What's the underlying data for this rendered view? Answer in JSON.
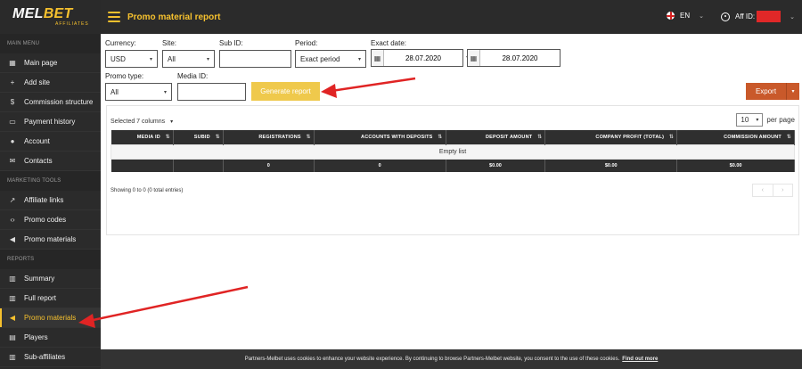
{
  "brand": {
    "name_left": "MEL",
    "name_right": "BET",
    "sub": "AFFILIATES"
  },
  "topbar": {
    "title": "Promo material report",
    "language": "EN",
    "aff_label": "Aff ID:"
  },
  "sidebar": {
    "sections": [
      {
        "title": "MAIN MENU",
        "items": [
          {
            "label": "Main page",
            "icon": "dashboard-icon"
          },
          {
            "label": "Add site",
            "icon": "plus-icon"
          },
          {
            "label": "Commission structure",
            "icon": "dollar-icon"
          },
          {
            "label": "Payment history",
            "icon": "wallet-icon"
          },
          {
            "label": "Account",
            "icon": "user-icon"
          },
          {
            "label": "Contacts",
            "icon": "envelope-icon"
          }
        ]
      },
      {
        "title": "MARKETING TOOLS",
        "items": [
          {
            "label": "Affiliate links",
            "icon": "external-link-icon"
          },
          {
            "label": "Promo codes",
            "icon": "code-icon"
          },
          {
            "label": "Promo materials",
            "icon": "megaphone-icon"
          }
        ]
      },
      {
        "title": "REPORTS",
        "items": [
          {
            "label": "Summary",
            "icon": "bar-chart-icon"
          },
          {
            "label": "Full report",
            "icon": "bar-chart-icon"
          },
          {
            "label": "Promo materials",
            "icon": "megaphone-icon",
            "active": true
          },
          {
            "label": "Players",
            "icon": "id-card-icon"
          },
          {
            "label": "Sub-affiliates",
            "icon": "bar-chart-icon"
          }
        ]
      }
    ]
  },
  "filters": {
    "currency": {
      "label": "Currency:",
      "value": "USD"
    },
    "site": {
      "label": "Site:",
      "value": "All"
    },
    "sub_id": {
      "label": "Sub ID:",
      "value": ""
    },
    "period": {
      "label": "Period:",
      "value": "Exact period"
    },
    "exact_date": {
      "label": "Exact date:",
      "from": "28.07.2020",
      "separator": "-",
      "to": "28.07.2020"
    },
    "promo_type": {
      "label": "Promo type:",
      "value": "All"
    },
    "media_id": {
      "label": "Media ID:",
      "value": ""
    },
    "generate_label": "Generate report",
    "export_label": "Export"
  },
  "table": {
    "columns_selected": "Selected 7 columns",
    "per_page_value": "10",
    "per_page_label": "per page",
    "headers": [
      "MEDIA ID",
      "SUBID",
      "REGISTRATIONS",
      "ACCOUNTS WITH DEPOSITS",
      "DEPOSIT AMOUNT",
      "COMPANY PROFIT (TOTAL)",
      "COMMISSION AMOUNT"
    ],
    "empty_text": "Empty list",
    "totals": [
      "",
      "",
      "0",
      "0",
      "$0.00",
      "$0.00",
      "$0.00"
    ],
    "showing": "Showing 0 to 0 (0 total entries)"
  },
  "footer": {
    "text": "Partners-Melbet uses cookies to enhance your website experience. By continuing to browse Partners-Melbet website, you consent to the use of these cookies.",
    "link": "Find out more"
  },
  "colors": {
    "accent": "#f6c12e",
    "sidebar": "#2b2b2b",
    "export": "#c9592a",
    "annotation_arrow": "#e02424"
  }
}
